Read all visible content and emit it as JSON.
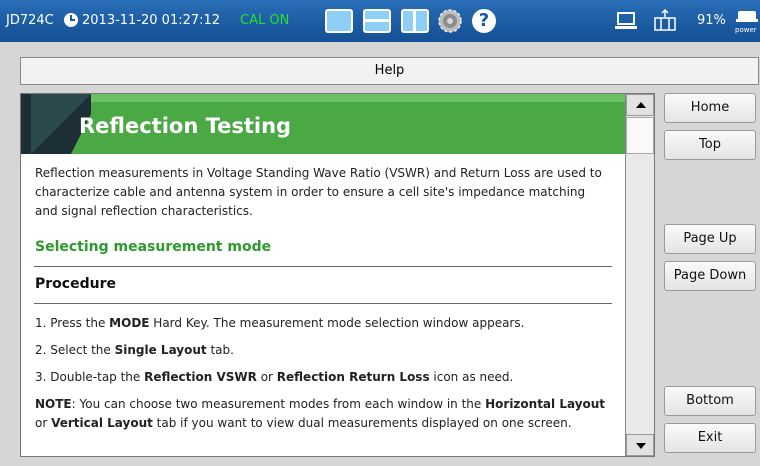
{
  "status_bar": {
    "model": "JD724C",
    "datetime": "2013-11-20 01:27:12",
    "cal_status": "CAL ON",
    "battery": "91%",
    "power_label": "power"
  },
  "help_window": {
    "title": "Help"
  },
  "content": {
    "page_title": "Reflection Testing",
    "intro": "Reflection measurements in Voltage Standing Wave Ratio (VSWR) and Return Loss are used to characterize cable and antenna system in order to ensure a cell site's impedance matching and signal reflection characteristics.",
    "section_heading": "Selecting measurement mode",
    "procedure_heading": "Procedure",
    "step1": {
      "a": "1. Press the ",
      "b": "MODE",
      "c": " Hard Key. The measurement mode selection window appears."
    },
    "step2": {
      "a": "2. Select the ",
      "b": "Single Layout",
      "c": " tab."
    },
    "step3": {
      "a": "3. Double-tap the ",
      "b": "Reflection VSWR",
      "c": " or ",
      "d": "Reflection Return Loss",
      "e": " icon as need."
    },
    "note": {
      "a": "NOTE",
      "b": ": You can choose two measurement modes from each window in the ",
      "c": "Horizontal Layout",
      "d": " or ",
      "e": "Vertical Layout",
      "f": " tab if you want to view dual measurements displayed on one screen."
    }
  },
  "side_buttons": {
    "home": "Home",
    "top": "Top",
    "page_up": "Page Up",
    "page_down": "Page Down",
    "bottom": "Bottom",
    "exit": "Exit"
  },
  "icons": {
    "clock": "clock-icon",
    "layout_single": "layout-single-icon",
    "layout_horizontal": "layout-horizontal-icon",
    "layout_vertical": "layout-vertical-icon",
    "settings": "gear-icon",
    "help": "help-question-icon",
    "laptop": "laptop-icon",
    "network": "network-icon",
    "power": "power-plug-icon"
  },
  "colors": {
    "status_bar": "#1a5aa0",
    "cal_on": "#27e02c",
    "banner_green": "#4aa845",
    "section_green": "#2c9a2c"
  }
}
